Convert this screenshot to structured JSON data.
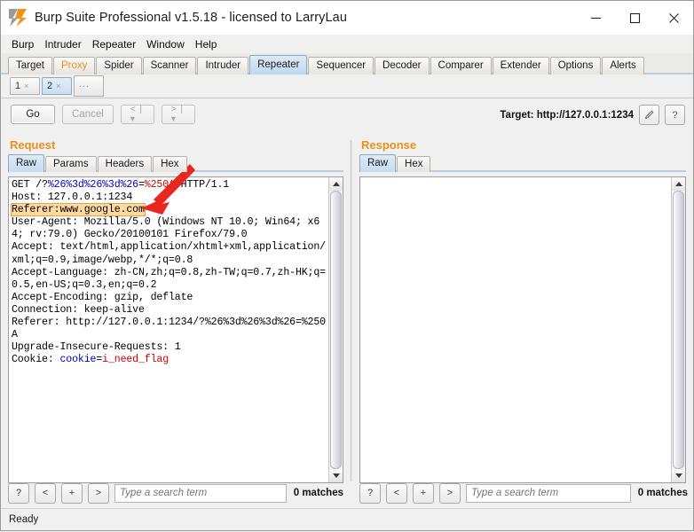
{
  "window": {
    "title": "Burp Suite Professional v1.5.18 - licensed to LarryLau",
    "logo_icon": "burp-logo-icon",
    "minimize_icon": "minimize-icon",
    "maximize_icon": "maximize-icon",
    "close_icon": "close-icon"
  },
  "menu": {
    "items": [
      {
        "label": "Burp"
      },
      {
        "label": "Intruder"
      },
      {
        "label": "Repeater"
      },
      {
        "label": "Window"
      },
      {
        "label": "Help"
      }
    ]
  },
  "main_tabs": {
    "items": [
      {
        "label": "Target",
        "selected": false,
        "accent": false
      },
      {
        "label": "Proxy",
        "selected": false,
        "accent": true
      },
      {
        "label": "Spider",
        "selected": false,
        "accent": false
      },
      {
        "label": "Scanner",
        "selected": false,
        "accent": false
      },
      {
        "label": "Intruder",
        "selected": false,
        "accent": false
      },
      {
        "label": "Repeater",
        "selected": true,
        "accent": false
      },
      {
        "label": "Sequencer",
        "selected": false,
        "accent": false
      },
      {
        "label": "Decoder",
        "selected": false,
        "accent": false
      },
      {
        "label": "Comparer",
        "selected": false,
        "accent": false
      },
      {
        "label": "Extender",
        "selected": false,
        "accent": false
      },
      {
        "label": "Options",
        "selected": false,
        "accent": false
      },
      {
        "label": "Alerts",
        "selected": false,
        "accent": false
      }
    ]
  },
  "sub_tabs": {
    "items": [
      {
        "label": "1",
        "close": "×",
        "selected": false
      },
      {
        "label": "2",
        "close": "×",
        "selected": true
      }
    ],
    "more_label": "..."
  },
  "toolbar": {
    "go_label": "Go",
    "cancel_label": "Cancel",
    "back_label": "< | ▾",
    "forward_label": "> | ▾",
    "target_label": "Target: http://127.0.0.1:1234",
    "edit_icon": "pencil-icon",
    "help_label": "?"
  },
  "request_panel": {
    "title": "Request",
    "tabs": [
      {
        "label": "Raw",
        "selected": true
      },
      {
        "label": "Params",
        "selected": false
      },
      {
        "label": "Headers",
        "selected": false
      },
      {
        "label": "Hex",
        "selected": false
      }
    ],
    "lines": [
      {
        "segments": [
          {
            "t": "GET /?",
            "c": "plain"
          },
          {
            "t": "%26%3d%26%3d%26",
            "c": "blue"
          },
          {
            "t": "=",
            "c": "plain"
          },
          {
            "t": "%250A",
            "c": "red"
          },
          {
            "t": " HTTP/1.1",
            "c": "plain"
          }
        ]
      },
      {
        "segments": [
          {
            "t": "Host: 127.0.0.1:1234",
            "c": "plain"
          }
        ]
      },
      {
        "highlight": true,
        "segments": [
          {
            "t": "Referer:www.google.com",
            "c": "plain"
          }
        ]
      },
      {
        "segments": [
          {
            "t": "User-Agent: Mozilla/5.0 (Windows NT 10.0; Win64; x64; rv:79.0) Gecko/20100101 Firefox/79.0",
            "c": "plain"
          }
        ]
      },
      {
        "segments": [
          {
            "t": "Accept: text/html,application/xhtml+xml,application/xml;q=0.9,image/webp,*/*;q=0.8",
            "c": "plain"
          }
        ]
      },
      {
        "segments": [
          {
            "t": "Accept-Language: zh-CN,zh;q=0.8,zh-TW;q=0.7,zh-HK;q=0.5,en-US;q=0.3,en;q=0.2",
            "c": "plain"
          }
        ]
      },
      {
        "segments": [
          {
            "t": "Accept-Encoding: gzip, deflate",
            "c": "plain"
          }
        ]
      },
      {
        "segments": [
          {
            "t": "Connection: keep-alive",
            "c": "plain"
          }
        ]
      },
      {
        "segments": [
          {
            "t": "Referer: http://127.0.0.1:1234/?%26%3d%26%3d%26=%250A",
            "c": "plain"
          }
        ]
      },
      {
        "segments": [
          {
            "t": "Upgrade-Insecure-Requests: 1",
            "c": "plain"
          }
        ]
      },
      {
        "segments": [
          {
            "t": "Cookie: ",
            "c": "plain"
          },
          {
            "t": "cookie",
            "c": "blue"
          },
          {
            "t": "=",
            "c": "plain"
          },
          {
            "t": "i_need_flag",
            "c": "red"
          }
        ]
      }
    ],
    "search": {
      "help_label": "?",
      "prev_label": "<",
      "add_label": "+",
      "next_label": ">",
      "placeholder": "Type a search term",
      "value": "",
      "matches": "0 matches"
    }
  },
  "response_panel": {
    "title": "Response",
    "tabs": [
      {
        "label": "Raw",
        "selected": true
      },
      {
        "label": "Hex",
        "selected": false
      }
    ],
    "body": "",
    "search": {
      "help_label": "?",
      "prev_label": "<",
      "add_label": "+",
      "next_label": ">",
      "placeholder": "Type a search term",
      "value": "",
      "matches": "0 matches"
    }
  },
  "status": {
    "text": "Ready"
  },
  "annotation": {
    "arrow_icon": "red-arrow-annotation",
    "color": "#e8271f"
  },
  "colors": {
    "accent_orange": "#e8911a",
    "tab_selected": "#c5dcf0",
    "highlight": "#ffd9a0",
    "code_blue": "#0000c8",
    "code_red": "#d00000"
  }
}
